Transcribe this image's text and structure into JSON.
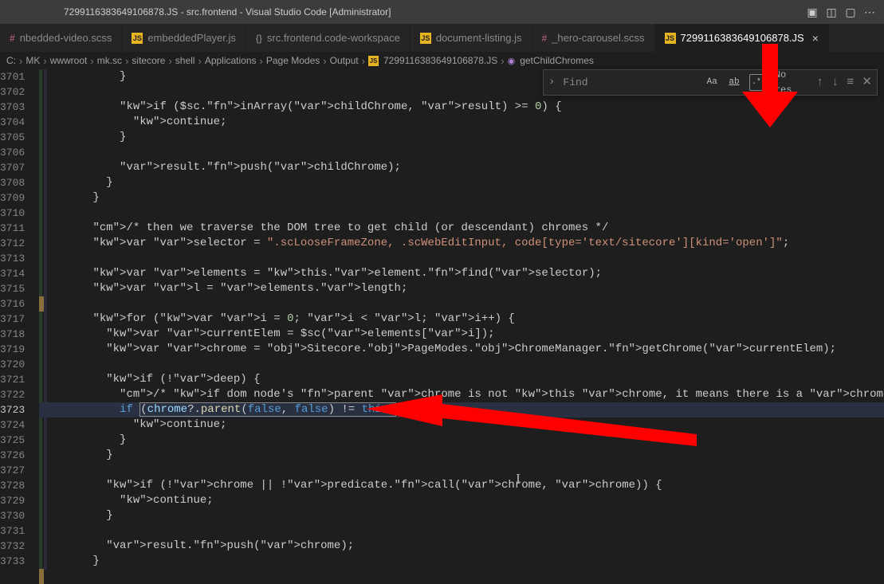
{
  "title": "7299116383649106878.JS - src.frontend - Visual Studio Code [Administrator]",
  "tabs": [
    {
      "label": "nbedded-video.scss",
      "kind": "sass"
    },
    {
      "label": "embeddedPlayer.js",
      "kind": "js"
    },
    {
      "label": "src.frontend.code-workspace",
      "kind": "layers"
    },
    {
      "label": "document-listing.js",
      "kind": "js"
    },
    {
      "label": "_hero-carousel.scss",
      "kind": "sass"
    },
    {
      "label": "7299116383649106878.JS",
      "kind": "js",
      "active": true,
      "close": true
    }
  ],
  "breadcrumb": [
    "C:",
    "MK",
    "wwwroot",
    "mk.sc",
    "sitecore",
    "shell",
    "Applications",
    "Page Modes",
    "Output",
    "7299116383649106878.JS",
    "getChildChromes"
  ],
  "find": {
    "placeholder": "Find",
    "result": "No res",
    "options": {
      "case": "Aa",
      "word": "ab",
      "regex": ".*"
    }
  },
  "first_line": 3701,
  "current_line": 3723,
  "code_lines": [
    "            }",
    "",
    "            if ($sc.inArray(childChrome, result) >= 0) {",
    "              continue;",
    "            }",
    "",
    "            result.push(childChrome);",
    "          }",
    "        }",
    "",
    "        /* then we traverse the DOM tree to get child (or descendant) chromes */",
    "        var selector = \".scLooseFrameZone, .scWebEditInput, code[type='text/sitecore'][kind='open']\";",
    "",
    "        var elements = this.element.find(selector);",
    "        var l = elements.length;",
    "",
    "        for (var i = 0; i < l; i++) {",
    "          var currentElem = $sc(elements[i]);",
    "          var chrome = Sitecore.PageModes.ChromeManager.getChrome(currentElem);",
    "",
    "          if (!deep) {",
    "            /* if dom node's parent chrome is not this chrome, it means there is a chrome in between, so we disregard it a descendant, but ",
    "            if (chrome?.parent(false, false) != this) {",
    "              continue;",
    "            }",
    "          }",
    "",
    "          if (!chrome || !predicate.call(chrome, chrome)) {",
    "            continue;",
    "          }",
    "",
    "          result.push(chrome);",
    "        }"
  ]
}
